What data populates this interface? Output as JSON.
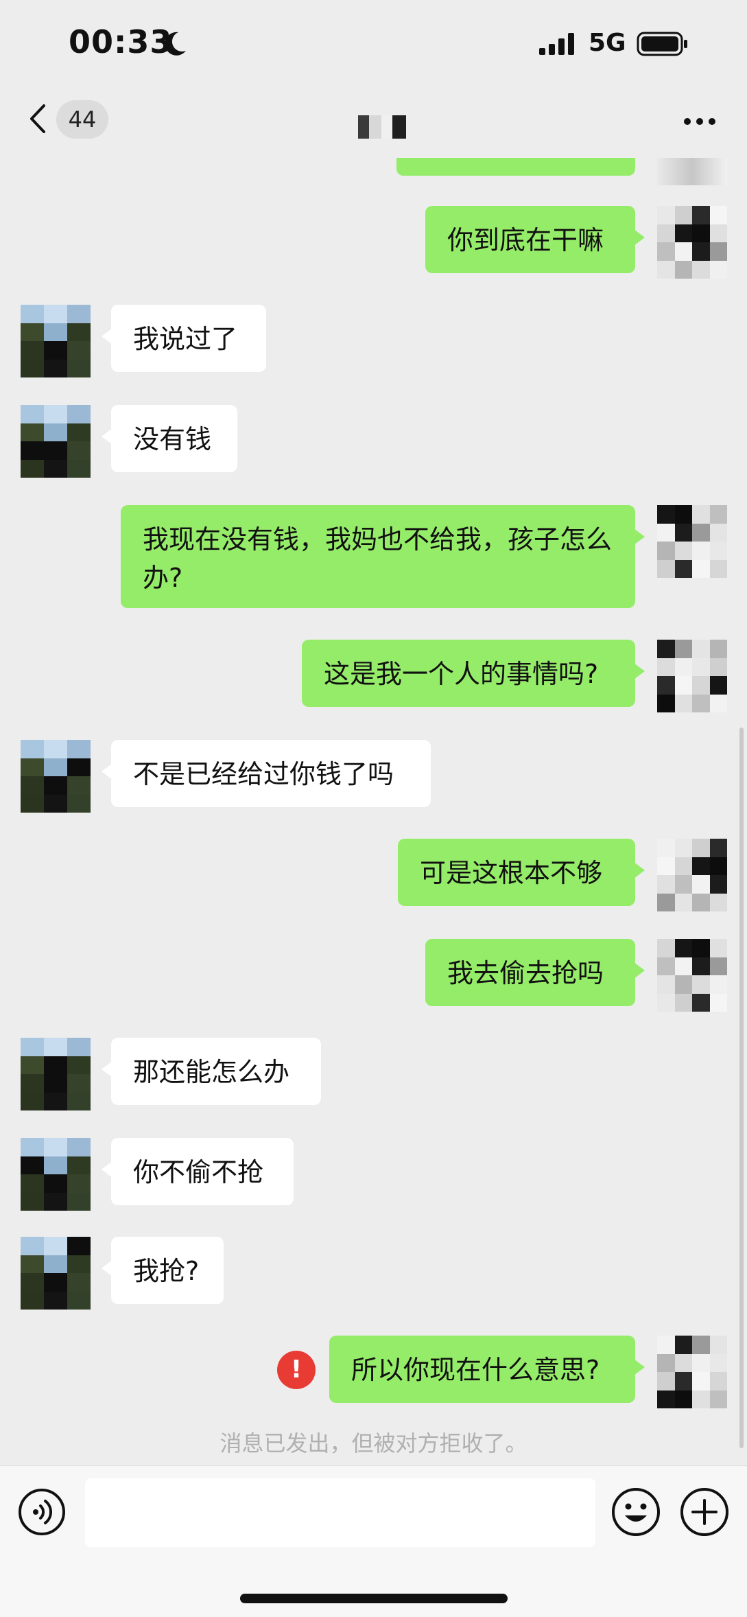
{
  "status_bar": {
    "time": "00:33",
    "network": "5G"
  },
  "nav": {
    "badge_count": "44",
    "more_icon": "ellipsis-icon"
  },
  "messages": [
    {
      "side": "me",
      "text": "你到底在干嘛"
    },
    {
      "side": "them",
      "text": "我说过了"
    },
    {
      "side": "them",
      "text": "没有钱"
    },
    {
      "side": "me",
      "text": "我现在没有钱，我妈也不给我，孩子怎么办?"
    },
    {
      "side": "me",
      "text": "这是我一个人的事情吗?"
    },
    {
      "side": "them",
      "text": "不是已经给过你钱了吗"
    },
    {
      "side": "me",
      "text": "可是这根本不够"
    },
    {
      "side": "me",
      "text": "我去偷去抢吗"
    },
    {
      "side": "them",
      "text": "那还能怎么办"
    },
    {
      "side": "them",
      "text": "你不偷不抢"
    },
    {
      "side": "them",
      "text": "我抢?"
    },
    {
      "side": "me",
      "text": "所以你现在什么意思?",
      "error": true
    }
  ],
  "error_icon_text": "!",
  "system_note": "消息已发出，但被对方拒收了。",
  "input": {
    "placeholder": "",
    "voice_icon": "voice-icon",
    "emoji_icon": "emoji-icon",
    "plus_icon": "plus-icon"
  },
  "colors": {
    "background": "#ededed",
    "my_bubble": "#95ec69",
    "their_bubble": "#ffffff",
    "error": "#e83b33"
  }
}
